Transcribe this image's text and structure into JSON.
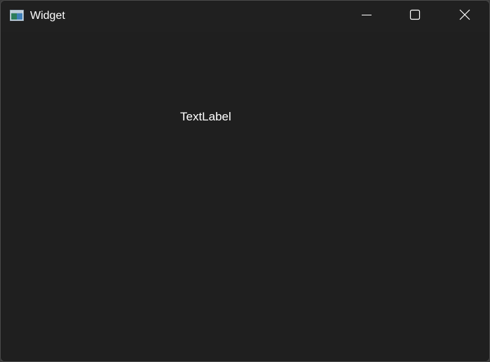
{
  "window": {
    "title": "Widget",
    "icon": "app-window-icon",
    "controls": {
      "minimize_icon": "minimize-icon",
      "maximize_icon": "maximize-icon",
      "close_icon": "close-icon"
    }
  },
  "content": {
    "label_text": "TextLabel"
  },
  "colors": {
    "background": "#1f1f1f",
    "text": "#ffffff"
  }
}
